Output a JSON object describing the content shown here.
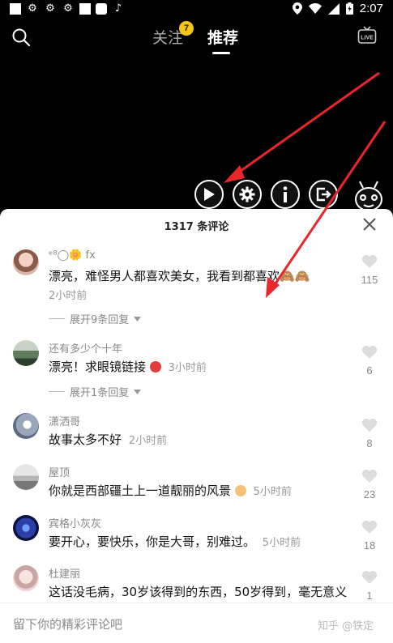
{
  "status_bar": {
    "time": "2:07"
  },
  "nav": {
    "tab_follow": "关注",
    "follow_badge": "7",
    "tab_recommend": "推荐"
  },
  "toolbar": [
    {
      "label": "自动",
      "icon": "play-icon"
    },
    {
      "label": "设置",
      "icon": "gear-icon"
    },
    {
      "label": "说明",
      "icon": "info-icon"
    },
    {
      "label": "退出",
      "icon": "exit-icon"
    }
  ],
  "sheet": {
    "title": "1317 条评论",
    "input_placeholder": "留下你的精彩评论吧",
    "watermark": "知乎 @铁定"
  },
  "comments": [
    {
      "user": "ᵉ⁸◯🌼 fx",
      "text": "漂亮，难怪男人都喜欢美女，我看到都喜欢🙈🙈",
      "time": "2小时前",
      "likes": "115",
      "expand": "展开9条回复"
    },
    {
      "user": "还有多少个十年",
      "text": "漂亮！求眼镜链接",
      "time": "3小时前",
      "likes": "6",
      "expand": "展开1条回复"
    },
    {
      "user": "潇洒哥",
      "text": "故事太多不好",
      "time": "2小时前",
      "likes": "8"
    },
    {
      "user": "屋顶",
      "text": "你就是西部疆土上一道靓丽的风景",
      "time": "5小时前",
      "likes": "23"
    },
    {
      "user": "宾格小灰灰",
      "text": "要开心，要快乐，你是大哥，别难过。",
      "time": "5小时前",
      "likes": "18"
    },
    {
      "user": "杜建丽",
      "text": "这话没毛病，30岁该得到的东西，50岁得到，毫无意义",
      "likes": "1"
    }
  ],
  "colors": {
    "accent_red": "#e8262c",
    "badge": "#f5c518"
  }
}
